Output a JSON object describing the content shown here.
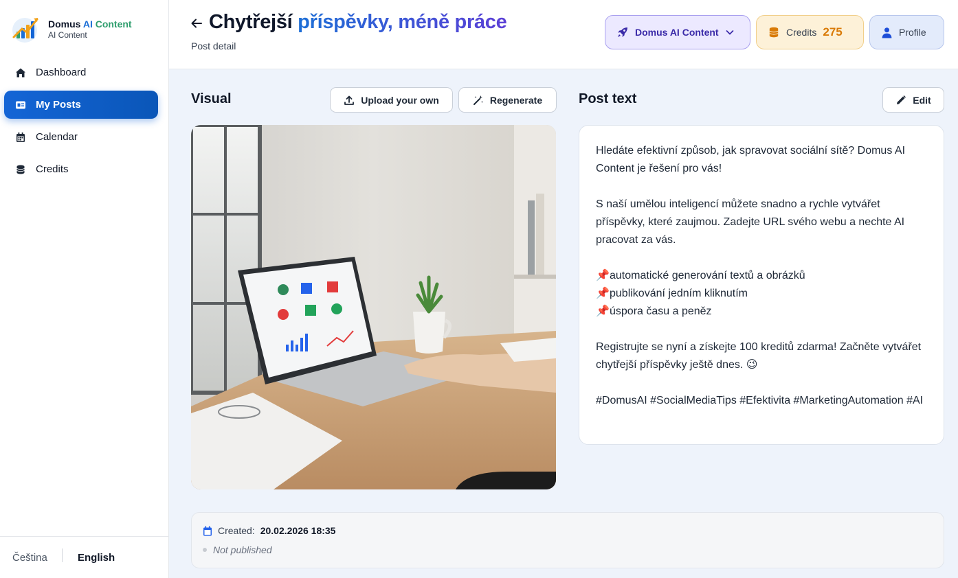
{
  "brand": {
    "name_part1": "Domus ",
    "name_part2": "AI",
    "name_part3": " Content",
    "tagline": "AI Content"
  },
  "sidebar": {
    "items": [
      {
        "label": "Dashboard",
        "icon": "home-icon",
        "active": false
      },
      {
        "label": "My Posts",
        "icon": "posts-icon",
        "active": true
      },
      {
        "label": "Calendar",
        "icon": "calendar-icon",
        "active": false
      },
      {
        "label": "Credits",
        "icon": "coins-icon",
        "active": false
      }
    ]
  },
  "language": {
    "czech": "Čeština",
    "english": "English",
    "selected": "English"
  },
  "header": {
    "title_plain": "Chytřejší ",
    "title_highlight": "příspěvky, méně práce",
    "subtitle": "Post detail",
    "workspace_label": "Domus AI Content",
    "credits_label": "Credits",
    "credits_value": "275",
    "profile_label": "Profile"
  },
  "visual": {
    "title": "Visual",
    "upload_label": "Upload your own",
    "regenerate_label": "Regenerate"
  },
  "post": {
    "title": "Post text",
    "edit_label": "Edit",
    "para1": "Hledáte efektivní způsob, jak spravovat sociální sítě? Domus AI Content je řešení pro vás!",
    "para2": "S naší umělou inteligencí můžete snadno a rychle vytvářet příspěvky, které zaujmou. Zadejte URL svého webu a nechte AI pracovat za vás.",
    "bullets": [
      "automatické generování textů a obrázků",
      "publikování jedním kliknutím",
      "úspora času a peněz"
    ],
    "bullet_emoji": "📌",
    "para3": "Registrujte se nyní a získejte 100 kreditů zdarma! Začněte vytvářet chytřejší příspěvky ještě dnes. 😉",
    "hashtags": "#DomusAI #SocialMediaTips #Efektivita #MarketingAutomation #AI"
  },
  "meta": {
    "created_label": "Created:",
    "created_value": "20.02.2026 18:35",
    "status": "Not published"
  },
  "colors": {
    "primary": "#1465d6",
    "accent_purple": "#5b3fd6",
    "credits_orange": "#d97a06"
  }
}
